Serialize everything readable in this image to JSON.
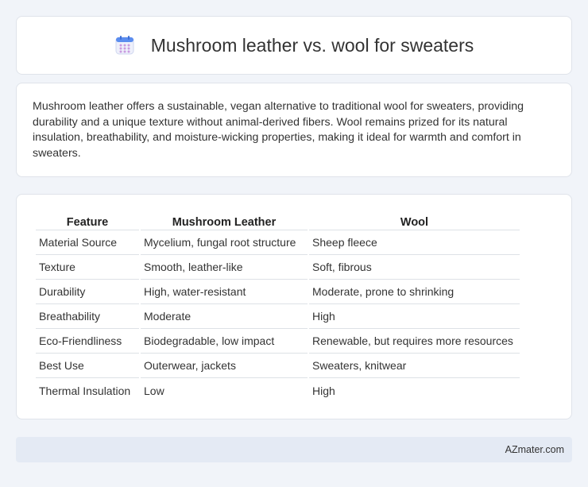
{
  "header": {
    "title": "Mushroom leather vs. wool for sweaters",
    "icon": "calendar-icon"
  },
  "description": "Mushroom leather offers a sustainable, vegan alternative to traditional wool for sweaters, providing durability and a unique texture without animal-derived fibers. Wool remains prized for its natural insulation, breathability, and moisture-wicking properties, making it ideal for warmth and comfort in sweaters.",
  "table": {
    "headers": [
      "Feature",
      "Mushroom Leather",
      "Wool"
    ],
    "rows": [
      [
        "Material Source",
        "Mycelium, fungal root structure",
        "Sheep fleece"
      ],
      [
        "Texture",
        "Smooth, leather-like",
        "Soft, fibrous"
      ],
      [
        "Durability",
        "High, water-resistant",
        "Moderate, prone to shrinking"
      ],
      [
        "Breathability",
        "Moderate",
        "High"
      ],
      [
        "Eco-Friendliness",
        "Biodegradable, low impact",
        "Renewable, but requires more resources"
      ],
      [
        "Best Use",
        "Outerwear, jackets",
        "Sweaters, knitwear"
      ],
      [
        "Thermal Insulation",
        "Low",
        "High"
      ]
    ]
  },
  "footer": {
    "brand": "AZmater.com"
  },
  "colors": {
    "background": "#f1f4f9",
    "icon_top": "#5b8def",
    "icon_grid": "#c99be0"
  }
}
